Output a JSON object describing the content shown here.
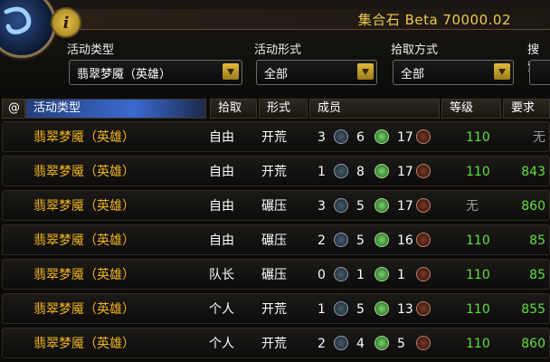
{
  "window": {
    "title": "集合石 Beta 70000.02"
  },
  "filters": {
    "activity_type": {
      "label": "活动类型",
      "value": "翡翠梦魇（英雄）"
    },
    "activity_form": {
      "label": "活动形式",
      "value": "全部"
    },
    "loot_method": {
      "label": "拾取方式",
      "value": "全部"
    },
    "search": {
      "label": "搜索"
    }
  },
  "columns": {
    "at": "@",
    "activity_type": "活动类型",
    "loot": "拾取",
    "form": "形式",
    "members": "成员",
    "level": "等级",
    "requirement": "要求"
  },
  "rows": [
    {
      "activity": "翡翠梦魇（英雄）",
      "loot": "自由",
      "form": "开荒",
      "tank": "3",
      "heal": "6",
      "dps": "17",
      "level": "110",
      "requirement": "无"
    },
    {
      "activity": "翡翠梦魇（英雄）",
      "loot": "自由",
      "form": "开荒",
      "tank": "1",
      "heal": "8",
      "dps": "17",
      "level": "110",
      "requirement": "843"
    },
    {
      "activity": "翡翠梦魇（英雄）",
      "loot": "自由",
      "form": "碾压",
      "tank": "3",
      "heal": "5",
      "dps": "17",
      "level": "无",
      "requirement": "860"
    },
    {
      "activity": "翡翠梦魇（英雄）",
      "loot": "自由",
      "form": "碾压",
      "tank": "2",
      "heal": "5",
      "dps": "16",
      "level": "110",
      "requirement": "85"
    },
    {
      "activity": "翡翠梦魇（英雄）",
      "loot": "队长",
      "form": "碾压",
      "tank": "0",
      "heal": "1",
      "dps": "1",
      "level": "110",
      "requirement": "85"
    },
    {
      "activity": "翡翠梦魇（英雄）",
      "loot": "个人",
      "form": "开荒",
      "tank": "1",
      "heal": "5",
      "dps": "13",
      "level": "110",
      "requirement": "855"
    },
    {
      "activity": "翡翠梦魇（英雄）",
      "loot": "个人",
      "form": "开荒",
      "tank": "2",
      "heal": "4",
      "dps": "5",
      "level": "110",
      "requirement": "860"
    }
  ]
}
